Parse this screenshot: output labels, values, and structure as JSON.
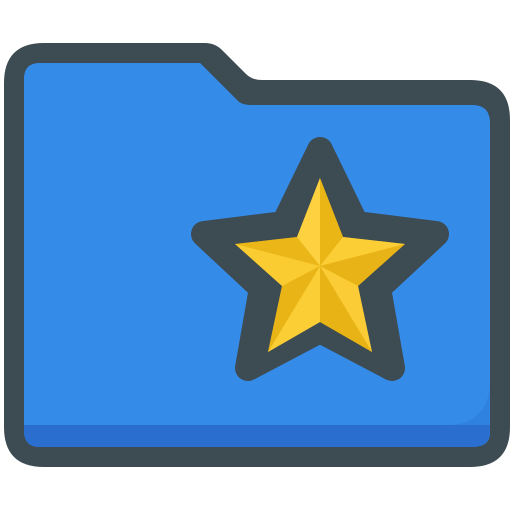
{
  "icon": {
    "name": "folder-star",
    "colors": {
      "outline": "#3d4b52",
      "folder_fill": "#2f82e0",
      "folder_highlight": "#3b93ee",
      "folder_shadow": "#2a6fd0",
      "star_fill": "#f6c21b",
      "star_dark": "#e2ad14",
      "star_light": "#ffd54a"
    }
  }
}
